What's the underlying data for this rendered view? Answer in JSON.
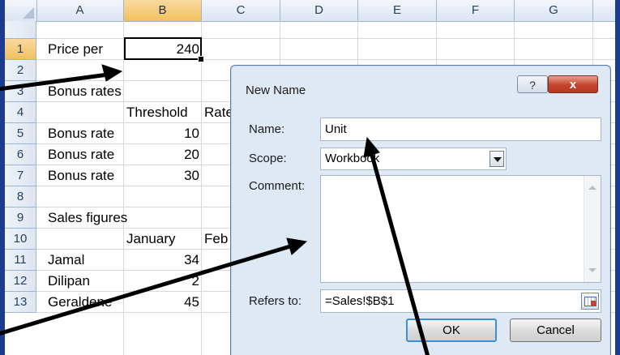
{
  "spreadsheet": {
    "columns": [
      "A",
      "B",
      "C",
      "D",
      "E",
      "F",
      "G"
    ],
    "rows": [
      "1",
      "2",
      "3",
      "4",
      "5",
      "6",
      "7",
      "8",
      "9",
      "10",
      "11",
      "12",
      "13"
    ],
    "cells": {
      "A1": "Price per",
      "B1": "240",
      "A3": "Bonus rates",
      "B4": "Threshold",
      "C4": "Rate",
      "A5": "Bonus rate",
      "B5": "10",
      "A6": "Bonus rate",
      "B6": "20",
      "A7": "Bonus rate",
      "B7": "30",
      "A9": "Sales figures",
      "B10": "January",
      "C10": "Feb",
      "A11": "Jamal",
      "B11": "34",
      "A12": "Dilipan",
      "B12": "2",
      "A13": "Geraldene",
      "B13": "45"
    },
    "selected_cell": "B1"
  },
  "dialog": {
    "title": "New Name",
    "help_icon": "?",
    "close_icon": "x",
    "name_label": "Name:",
    "name_value": "Unit",
    "scope_label": "Scope:",
    "scope_value": "Workbook",
    "comment_label": "Comment:",
    "comment_value": "",
    "refers_label": "Refers to:",
    "refers_value": "=Sales!$B$1",
    "ok_label": "OK",
    "cancel_label": "Cancel"
  },
  "colors": {
    "frame": "#1c3d8f",
    "header_selected": "#f1c15f",
    "close_button": "#c5432d"
  }
}
